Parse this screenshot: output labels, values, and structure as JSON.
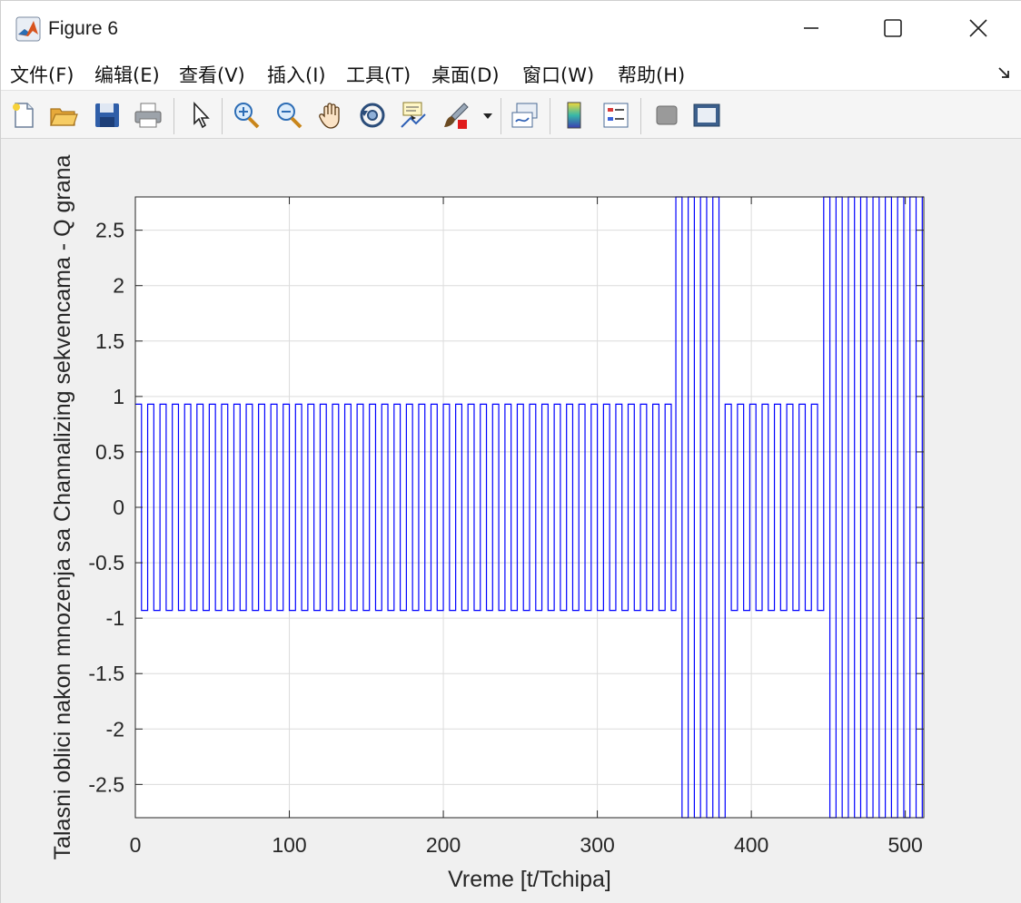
{
  "window": {
    "title": "Figure 6"
  },
  "menu": [
    "文件(F)",
    "编辑(E)",
    "查看(V)",
    "插入(I)",
    "工具(T)",
    "桌面(D)",
    "窗口(W)",
    "帮助(H)"
  ],
  "toolbar": {
    "icons": [
      "new-figure-icon",
      "open-file-icon",
      "save-icon",
      "print-icon",
      "select-pointer-icon",
      "zoom-in-icon",
      "zoom-out-icon",
      "pan-hand-icon",
      "rotate-3d-icon",
      "data-cursor-icon",
      "brush-icon",
      "brush-dropdown-icon",
      "link-plot-icon",
      "colorbar-icon",
      "legend-icon",
      "hide-plot-tools-icon",
      "show-plot-tools-icon"
    ]
  },
  "colors": {
    "series": "#0000ff",
    "grid": "#dcdcdc",
    "axes": "#262626",
    "figure_bg": "#f0f0f0",
    "plot_bg": "#ffffff"
  },
  "chart_data": {
    "type": "line",
    "step": true,
    "title": "",
    "xlabel": "Vreme [t/Tchipa]",
    "ylabel": "Talasni oblici nakon mnozenja sa Channalizing sekvencama - Q grana",
    "xlim": [
      0,
      512
    ],
    "ylim": [
      -2.8,
      2.8
    ],
    "xticks": [
      0,
      100,
      200,
      300,
      400,
      500
    ],
    "yticks": [
      -2.5,
      -2,
      -1.5,
      -1,
      -0.5,
      0,
      0.5,
      1,
      1.5,
      2,
      2.5
    ],
    "xtick_labels": [
      "0",
      "100",
      "200",
      "300",
      "400",
      "500"
    ],
    "ytick_labels": [
      "-2.5",
      "-2",
      "-1.5",
      "-1",
      "-0.5",
      "0",
      "0.5",
      "1",
      "1.5",
      "2",
      "2.5"
    ],
    "grid": true,
    "series": [
      {
        "segments": [
          {
            "x_start": 0,
            "x_end": 351,
            "pattern": "alternating",
            "levels": [
              0.93,
              -0.93
            ],
            "half_period": 4
          },
          {
            "x_start": 351,
            "x_end": 383,
            "pattern": "alternating",
            "levels": [
              2.8,
              -2.8
            ],
            "half_period": 4,
            "note": ""
          },
          {
            "x_start": 383,
            "x_end": 447,
            "pattern": "alternating",
            "levels": [
              0.93,
              -0.93
            ],
            "half_period": 4
          },
          {
            "x_start": 447,
            "x_end": 512,
            "pattern": "alternating",
            "levels": [
              2.8,
              -2.8
            ],
            "half_period": 4
          }
        ]
      }
    ]
  }
}
